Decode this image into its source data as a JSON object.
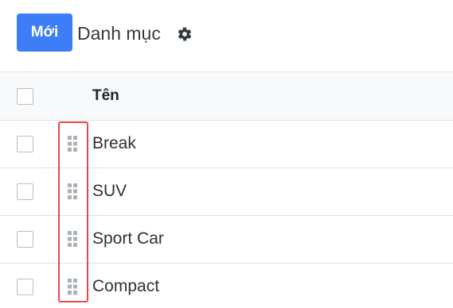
{
  "toolbar": {
    "new_label": "Mới",
    "breadcrumb_title": "Danh mục",
    "settings_icon": "gear-icon"
  },
  "table": {
    "columns": [
      "Tên"
    ],
    "rows": [
      {
        "name": "Break"
      },
      {
        "name": "SUV"
      },
      {
        "name": "Sport Car"
      },
      {
        "name": "Compact"
      }
    ]
  },
  "colors": {
    "accent": "#3d7ef6",
    "highlight": "#e8474c"
  }
}
